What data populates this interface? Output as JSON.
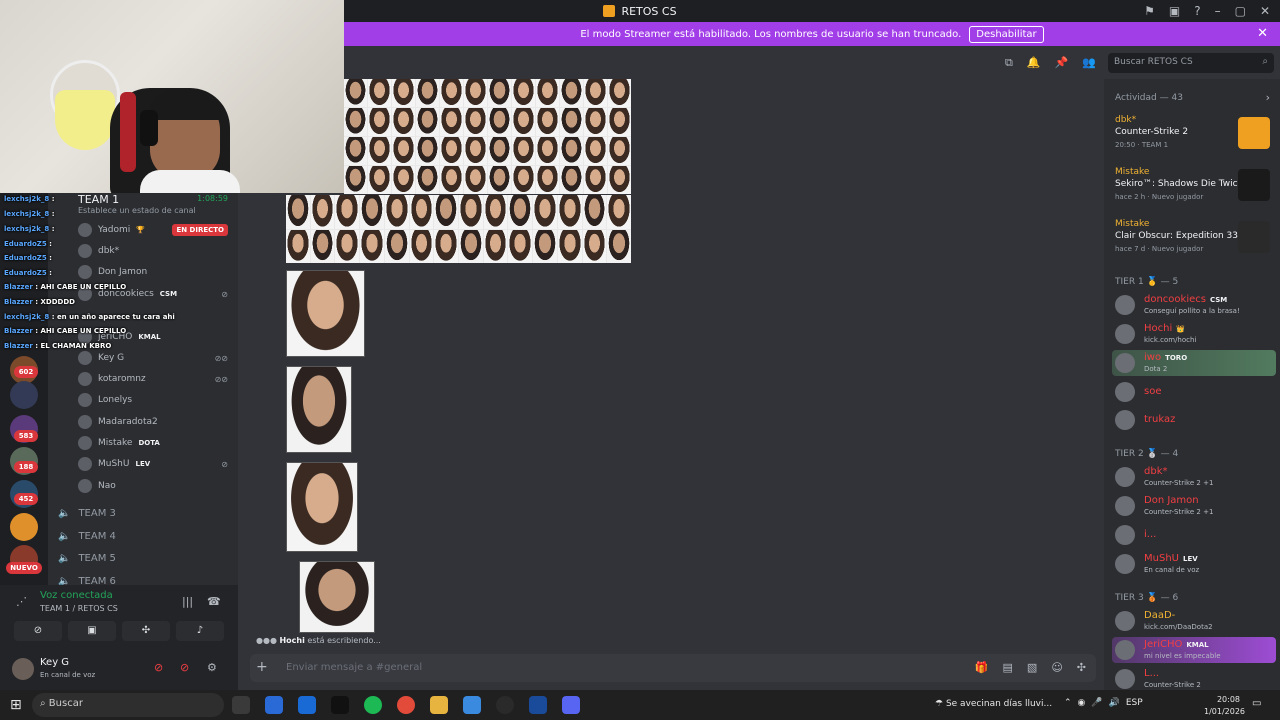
{
  "window": {
    "title": "RETOS CS"
  },
  "banner": {
    "text": "El modo Streamer está habilitado. Los nombres de usuario se han truncado.",
    "button": "Deshabilitar"
  },
  "search": {
    "placeholder": "Buscar RETOS CS"
  },
  "servers": {
    "badges": [
      "602",
      "583",
      "188",
      "452"
    ],
    "new_label": "NUEVO"
  },
  "voice_channel": {
    "name": "TEAM 1",
    "timer": "1:08:59",
    "status": "Establece un estado de canal",
    "live_badge": "EN DIRECTO",
    "members": [
      {
        "name": "Yadomi",
        "tag": "🏆"
      },
      {
        "name": "dbk*",
        "tag": ""
      },
      {
        "name": "Don Jamon",
        "tag": ""
      },
      {
        "name": "doncookiecs",
        "tag": "CSM"
      },
      {
        "name": "jeriCHO",
        "tag": "KMAL"
      },
      {
        "name": "Key G",
        "tag": ""
      },
      {
        "name": "kotaromnz",
        "tag": ""
      },
      {
        "name": "Lonelys",
        "tag": ""
      },
      {
        "name": "Madaradota2",
        "tag": ""
      },
      {
        "name": "Mistake",
        "tag": "DOTA"
      },
      {
        "name": "MuShU",
        "tag": "LEV"
      },
      {
        "name": "Nao",
        "tag": ""
      }
    ],
    "other_teams": [
      "TEAM 3",
      "TEAM 4",
      "TEAM 5",
      "TEAM 6"
    ]
  },
  "stream_chat": [
    {
      "user": "lexchsj2k_8",
      "msg": ":"
    },
    {
      "user": "lexchsj2k_8",
      "msg": ":"
    },
    {
      "user": "lexchsj2k_8",
      "msg": ":"
    },
    {
      "user": "EduardoZ5",
      "msg": ":"
    },
    {
      "user": "EduardoZ5",
      "msg": ":"
    },
    {
      "user": "EduardoZ5",
      "msg": ":"
    },
    {
      "user": "Blazzer",
      "msg": ": AHI CABE UN CEPILLO"
    },
    {
      "user": "Blazzer",
      "msg": ": XDDDDD"
    },
    {
      "user": "lexchsj2k_8",
      "msg": ": en un año aparece tu cara ahi"
    },
    {
      "user": "Blazzer",
      "msg": ": AHI CABE UN CEPILLO"
    },
    {
      "user": "Blazzer",
      "msg": ": EL CHAMAN KBRO"
    }
  ],
  "voice_panel": {
    "title": "Voz conectada",
    "subtitle": "TEAM 1 / RETOS CS",
    "user_name": "Key G",
    "user_status": "En canal de voz"
  },
  "chat": {
    "typing_user": "Hochi",
    "typing_text": "está escribiendo...",
    "composer_placeholder": "Enviar mensaje a #general"
  },
  "members_panel": {
    "activity_title": "Actividad — 43",
    "activities": [
      {
        "user": "dbk*",
        "game": "Counter-Strike 2",
        "meta": "20:50 · TEAM 1"
      },
      {
        "user": "Mistake",
        "game": "Sekiro™: Shadows Die Twice",
        "meta": "hace 2 h · Nuevo jugador"
      },
      {
        "user": "Mistake",
        "game": "Clair Obscur: Expedition 33",
        "meta": "hace 7 d · Nuevo jugador"
      }
    ],
    "tiers": [
      {
        "label": "TIER 1 🥇 — 5",
        "members": [
          {
            "name": "doncookiecs",
            "tag": "CSM",
            "status": "Conseguí pollito a la brasa!"
          },
          {
            "name": "Hochi",
            "tag": "👑",
            "status": "kick.com/hochi"
          },
          {
            "name": "iwo",
            "tag": "TORO",
            "status": "Dota 2"
          },
          {
            "name": "soe",
            "tag": "",
            "status": ""
          },
          {
            "name": "trukaz",
            "tag": "",
            "status": ""
          }
        ]
      },
      {
        "label": "TIER 2 🥈 — 4",
        "members": [
          {
            "name": "dbk*",
            "tag": "",
            "status": "Counter-Strike 2 +1"
          },
          {
            "name": "Don Jamon",
            "tag": "",
            "status": "Counter-Strike 2 +1"
          },
          {
            "name": "i...",
            "tag": "",
            "status": ""
          },
          {
            "name": "MuShU",
            "tag": "LEV",
            "status": "En canal de voz"
          }
        ]
      },
      {
        "label": "TIER 3 🥉 — 6",
        "members": [
          {
            "name": "DaaD-",
            "tag": "",
            "status": "kick.com/DaaDota2"
          },
          {
            "name": "JeriCHO",
            "tag": "KMAL",
            "status": "mi nivel es impecable"
          },
          {
            "name": "L...",
            "tag": "",
            "status": "Counter-Strike 2"
          }
        ]
      }
    ]
  },
  "taskbar": {
    "search_label": "Buscar",
    "weather": "Se avecinan días lluvi...",
    "lang": "ESP",
    "time": "20:08",
    "date": "1/01/2026"
  },
  "colors": {
    "streamer_banner": "#a23ee8",
    "live": "#da373c",
    "voice_green": "#23a55a"
  }
}
